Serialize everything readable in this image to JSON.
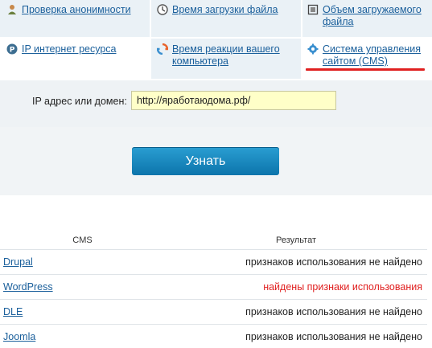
{
  "tools": [
    {
      "label": "Проверка анонимности",
      "icon": "person-icon"
    },
    {
      "label": "Время загрузки файла",
      "icon": "clock-icon"
    },
    {
      "label": "Объем загружаемого файла",
      "icon": "file-size-icon"
    },
    {
      "label": "IP интернет ресурса",
      "icon": "ip-icon"
    },
    {
      "label": "Время реакции вашего компьютера",
      "icon": "refresh-icon"
    },
    {
      "label": "Система управления сайтом (CMS)",
      "icon": "gear-icon"
    }
  ],
  "form": {
    "caption": "IP адрес или домен:",
    "value": "http://яработаюдома.рф/"
  },
  "button": {
    "label": "Узнать"
  },
  "table": {
    "headers": [
      "CMS",
      "Результат"
    ],
    "rows": [
      {
        "name": "Drupal",
        "result": "признаков использования не найдено",
        "found": false
      },
      {
        "name": "WordPress",
        "result": "найдены признаки использования",
        "found": true
      },
      {
        "name": "DLE",
        "result": "признаков использования не найдено",
        "found": false
      },
      {
        "name": "Joomla",
        "result": "признаков использования не найдено",
        "found": false
      }
    ]
  },
  "colors": {
    "link": "#1a5f9b",
    "found": "#e02020",
    "button": "#1588c0",
    "input_bg": "#ffffc8"
  }
}
